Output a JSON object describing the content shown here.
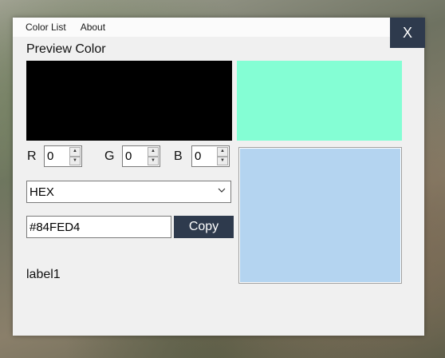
{
  "menu": {
    "items": [
      "Color List",
      "About"
    ]
  },
  "window": {
    "close_label": "X"
  },
  "preview": {
    "title": "Preview Color",
    "color": "#84FED4",
    "dark_color": "#000000"
  },
  "rgb": {
    "r_label": "R",
    "r_value": "0",
    "g_label": "G",
    "g_value": "0",
    "b_label": "B",
    "b_value": "0"
  },
  "swatch2": {
    "color": "#B4D4F0"
  },
  "format": {
    "selected": "HEX"
  },
  "hex": {
    "value": "#84FED4",
    "copy_label": "Copy"
  },
  "status": {
    "label": "label1"
  },
  "icons": {
    "close": "close-icon",
    "dropdown": "chevron-down-icon",
    "up": "arrow-up-icon",
    "down": "arrow-down-icon"
  }
}
